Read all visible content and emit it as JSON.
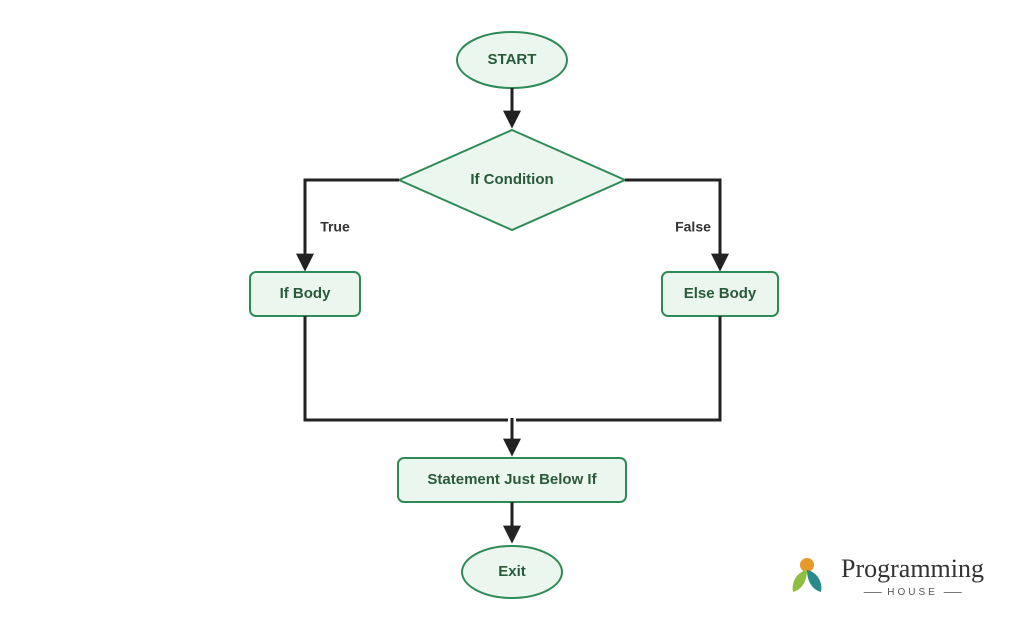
{
  "diagram": {
    "type": "flowchart",
    "nodes": {
      "start": {
        "label": "START",
        "shape": "terminator"
      },
      "condition": {
        "label": "If Condition",
        "shape": "decision"
      },
      "if_body": {
        "label": "If Body",
        "shape": "process"
      },
      "else_body": {
        "label": "Else Body",
        "shape": "process"
      },
      "below": {
        "label": "Statement Just Below If",
        "shape": "process"
      },
      "exit": {
        "label": "Exit",
        "shape": "terminator"
      }
    },
    "edges": {
      "true_label": "True",
      "false_label": "False"
    },
    "flow": [
      {
        "from": "start",
        "to": "condition"
      },
      {
        "from": "condition",
        "to": "if_body",
        "label_key": "true_label"
      },
      {
        "from": "condition",
        "to": "else_body",
        "label_key": "false_label"
      },
      {
        "from": "if_body",
        "to": "below"
      },
      {
        "from": "else_body",
        "to": "below"
      },
      {
        "from": "below",
        "to": "exit"
      }
    ],
    "colors": {
      "node_fill": "#eaf6ee",
      "node_stroke": "#2e8b57",
      "edge": "#222222",
      "text": "#2a5a3a"
    }
  },
  "branding": {
    "title": "Programming",
    "subtitle": "HOUSE"
  }
}
